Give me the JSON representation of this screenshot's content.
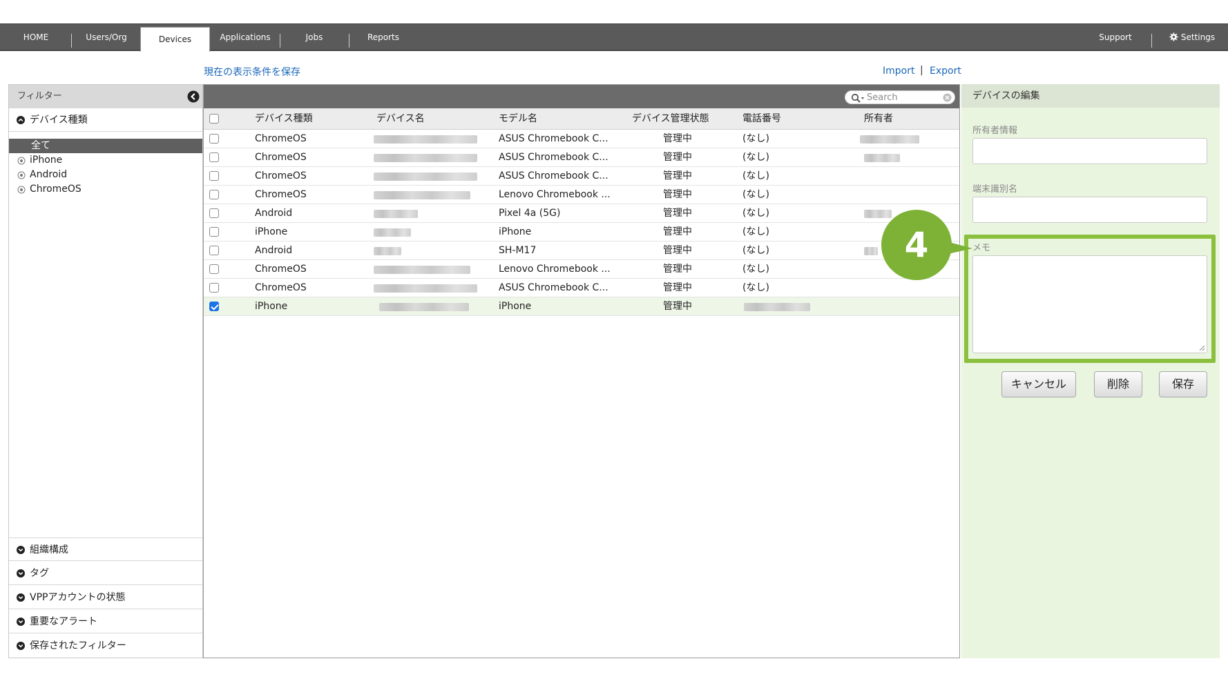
{
  "nav": {
    "items": [
      "HOME",
      "Users/Org",
      "Devices",
      "Applications",
      "Jobs",
      "Reports"
    ],
    "right": [
      "Support",
      "Settings"
    ],
    "active": "Devices"
  },
  "toolbar_links": {
    "save_view": "現在の表示条件を保存",
    "import": "Import",
    "separator": "|",
    "export": "Export"
  },
  "sidebar": {
    "title": "フィルター",
    "device_type_title": "デバイス種類",
    "options": [
      "全て",
      "iPhone",
      "Android",
      "ChromeOS"
    ],
    "sections": [
      "組織構成",
      "タグ",
      "VPPアカウントの状態",
      "重要なアラート",
      "保存されたフィルター"
    ]
  },
  "search": {
    "placeholder": "Search"
  },
  "table": {
    "headers": [
      "デバイス種類",
      "デバイス名",
      "モデル名",
      "デバイス管理状態",
      "電話番号",
      "所有者"
    ],
    "rows": [
      {
        "type": "ChromeOS",
        "model": "ASUS Chromebook C...",
        "state": "管理中",
        "phone": "(なし)",
        "checked": false
      },
      {
        "type": "ChromeOS",
        "model": "ASUS Chromebook C...",
        "state": "管理中",
        "phone": "(なし)",
        "checked": false
      },
      {
        "type": "ChromeOS",
        "model": "ASUS Chromebook C...",
        "state": "管理中",
        "phone": "(なし)",
        "checked": false
      },
      {
        "type": "ChromeOS",
        "model": "Lenovo Chromebook ...",
        "state": "管理中",
        "phone": "(なし)",
        "checked": false
      },
      {
        "type": "Android",
        "model": "Pixel 4a (5G)",
        "state": "管理中",
        "phone": "(なし)",
        "checked": false
      },
      {
        "type": "iPhone",
        "model": "iPhone",
        "state": "管理中",
        "phone": "(なし)",
        "checked": false
      },
      {
        "type": "Android",
        "model": "SH-M17",
        "state": "管理中",
        "phone": "(なし)",
        "checked": false
      },
      {
        "type": "ChromeOS",
        "model": "Lenovo Chromebook ...",
        "state": "管理中",
        "phone": "(なし)",
        "checked": false
      },
      {
        "type": "ChromeOS",
        "model": "ASUS Chromebook C...",
        "state": "管理中",
        "phone": "(なし)",
        "checked": false
      },
      {
        "type": "iPhone",
        "model": "iPhone",
        "state": "管理中",
        "phone": "",
        "checked": true
      }
    ]
  },
  "edit_panel": {
    "title": "デバイスの編集",
    "owner_label": "所有者情報",
    "alias_label": "端末識別名",
    "memo_label": "メモ",
    "cancel": "キャンセル",
    "delete": "削除",
    "save": "保存"
  },
  "step_badge": "4",
  "colors": {
    "nav_bg": "#5a5a5a",
    "link": "#1a66b8",
    "panel_bg": "#eaf5e0",
    "highlight": "#8bc03f",
    "badge": "#7db236",
    "checkbox_checked": "#1c73e8"
  }
}
